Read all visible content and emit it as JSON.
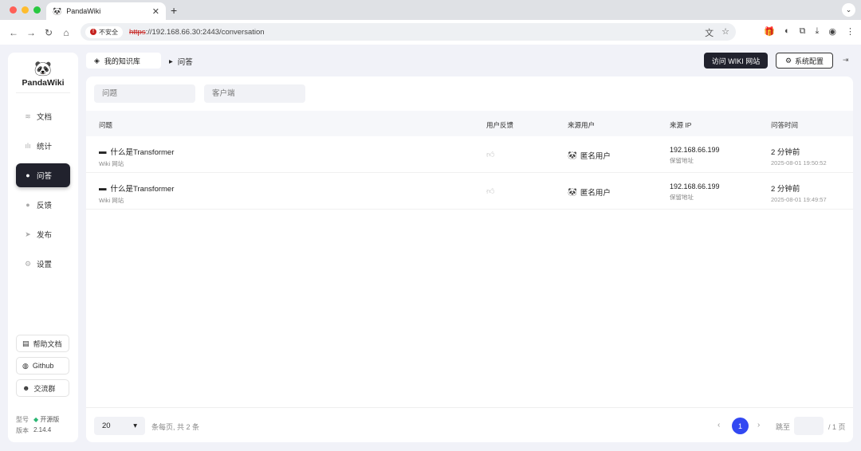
{
  "browser": {
    "tab_title": "PandaWiki",
    "tab_close": "✕",
    "new_tab": "+",
    "insecure_label": "不安全",
    "url_scheme": "https",
    "url_rest": "://192.168.66.30:2443/conversation"
  },
  "sidebar": {
    "brand": "PandaWiki",
    "items": [
      {
        "label": "文档",
        "icon": "docs-icon",
        "glyph": "≋"
      },
      {
        "label": "统计",
        "icon": "stats-icon",
        "glyph": "ılı"
      },
      {
        "label": "问答",
        "icon": "chat-icon",
        "glyph": "●"
      },
      {
        "label": "反馈",
        "icon": "feedback-icon",
        "glyph": "●"
      },
      {
        "label": "发布",
        "icon": "send-icon",
        "glyph": "➤"
      },
      {
        "label": "设置",
        "icon": "settings-icon",
        "glyph": "⚙"
      }
    ],
    "help_docs": "帮助文档",
    "github": "Github",
    "community": "交流群",
    "model_label": "型号",
    "model_value": "开源版",
    "version_label": "版本",
    "version_value": "2.14.4"
  },
  "header": {
    "kb_name": "我的知识库",
    "section": "问答",
    "visit_site": "访问 WIKI 网站",
    "system_config": "系统配置"
  },
  "filters": {
    "question_placeholder": "问题",
    "client_placeholder": "客户端"
  },
  "table": {
    "columns": {
      "question": "问题",
      "feedback": "用户反馈",
      "source_user": "来源用户",
      "source_ip": "来源 IP",
      "time": "问答时间"
    },
    "rows": [
      {
        "question": "什么是Transformer",
        "channel": "Wiki 网站",
        "user": "匿名用户",
        "ip": "192.168.66.199",
        "ip_note": "保留地址",
        "time_relative": "2 分钟前",
        "time_absolute": "2025-08-01 19:50:52"
      },
      {
        "question": "什么是Transformer",
        "channel": "Wiki 网站",
        "user": "匿名用户",
        "ip": "192.168.66.199",
        "ip_note": "保留地址",
        "time_relative": "2 分钟前",
        "time_absolute": "2025-08-01 19:49:57"
      }
    ]
  },
  "pagination": {
    "page_size": "20",
    "per_page_text": "条每页, 共 2 条",
    "current_page": "1",
    "jump_label": "跳至",
    "total_pages": "/ 1 页"
  }
}
